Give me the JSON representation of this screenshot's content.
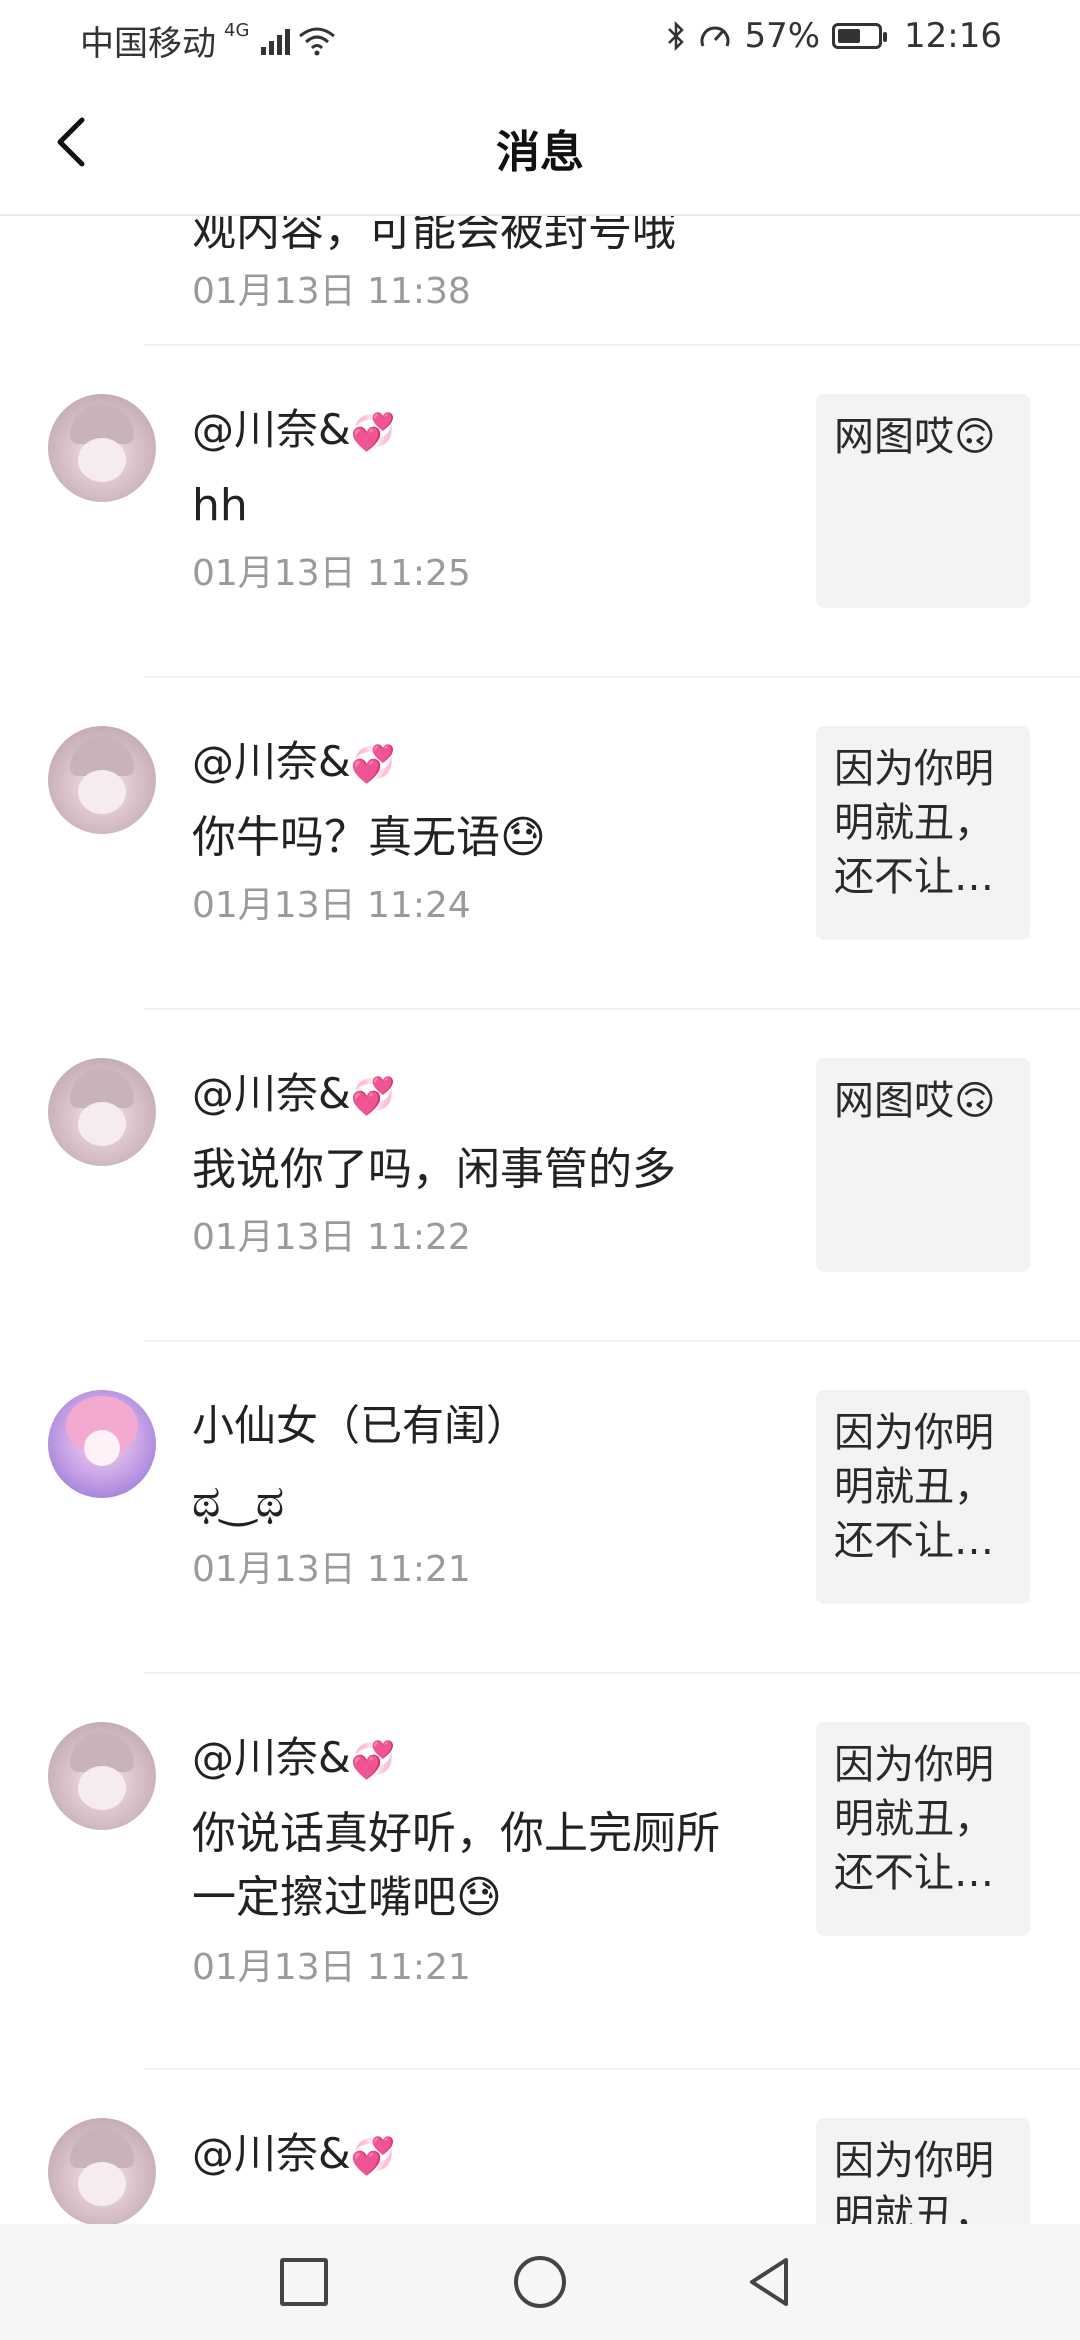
{
  "status_bar": {
    "carrier": "中国移动",
    "network": "4G",
    "battery_pct": "57%",
    "battery_level": 0.57,
    "time": "12:16"
  },
  "header": {
    "title": "消息"
  },
  "partial_top": {
    "text": "观内容，可能会被封号哦",
    "time": "01月13日 11:38"
  },
  "messages": [
    {
      "name": "@川奈&",
      "heart": "💞",
      "text": "hh",
      "time": "01月13日 11:25",
      "preview": "网图哎🙃"
    },
    {
      "name": "@川奈&",
      "heart": "💞",
      "text": "你牛吗？真无语😓",
      "time": "01月13日 11:24",
      "preview": "因为你明明就丑，还不让…"
    },
    {
      "name": "@川奈&",
      "heart": "💞",
      "text": "我说你了吗，闲事管的多",
      "time": "01月13日 11:22",
      "preview": "网图哎🙃"
    },
    {
      "name": "小仙女（已有闺）",
      "heart": "",
      "text": "ಥ‿ಥ",
      "time": "01月13日 11:21",
      "preview": "因为你明明就丑，还不让…"
    },
    {
      "name": "@川奈&",
      "heart": "💞",
      "text": "你说话真好听，你上完厕所一定擦过嘴吧😓",
      "time": "01月13日 11:21",
      "preview": "因为你明明就丑，还不让…"
    },
    {
      "name": "@川奈&",
      "heart": "💞",
      "text": "",
      "time": "",
      "preview": "因为你明明就丑，"
    }
  ],
  "icons": {
    "back": "chevron-left-icon",
    "nav_recent": "square-icon",
    "nav_home": "circle-icon",
    "nav_back": "triangle-back-icon"
  }
}
